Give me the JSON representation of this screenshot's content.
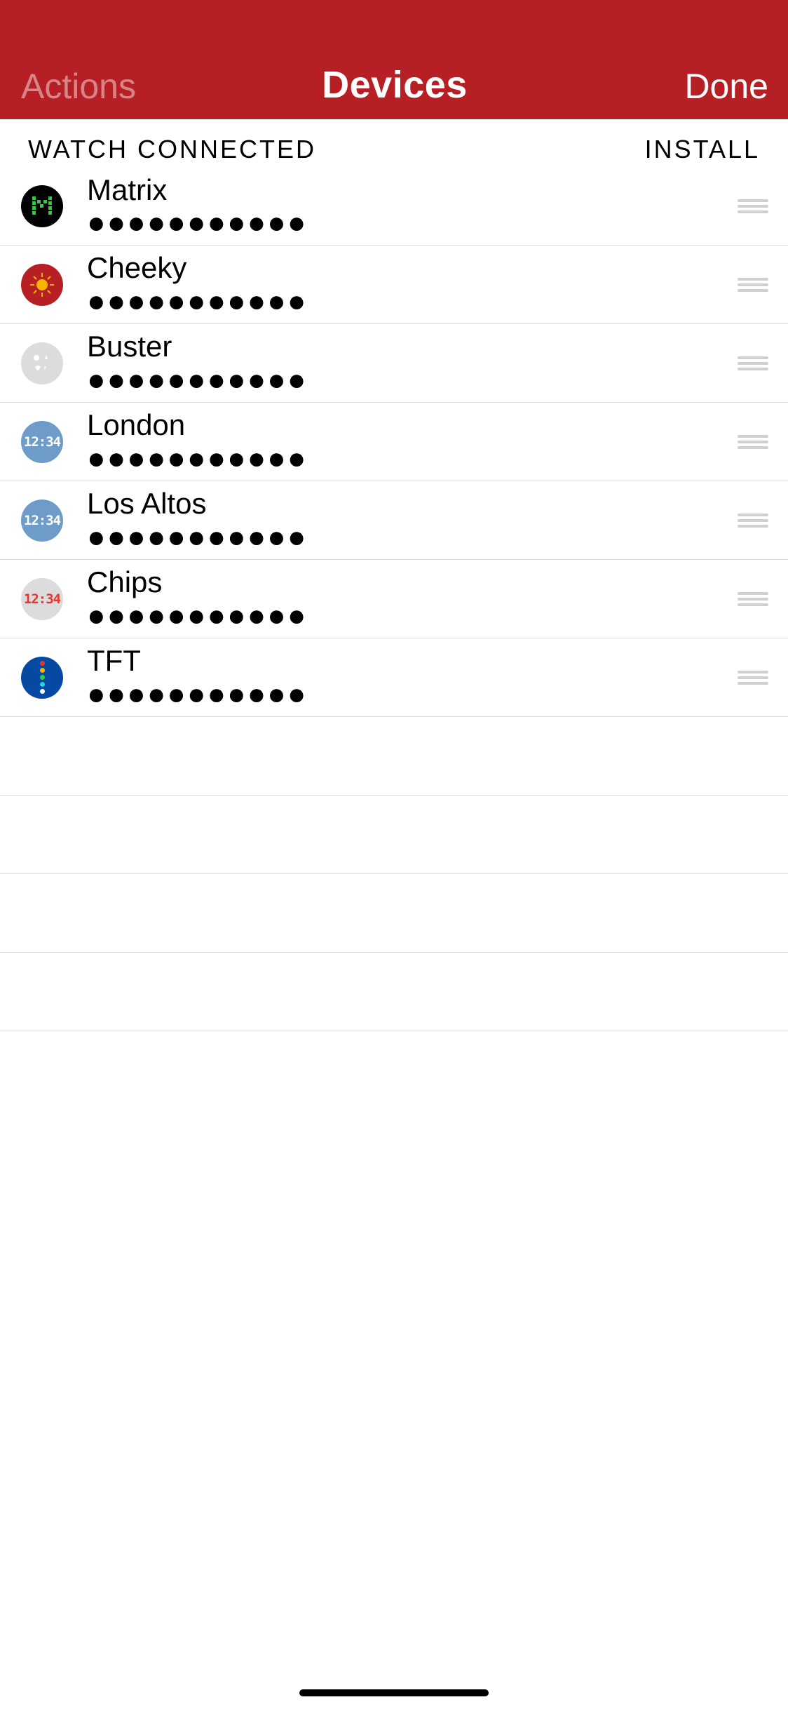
{
  "nav": {
    "left": "Actions",
    "title": "Devices",
    "right": "Done"
  },
  "section": {
    "left": "WATCH CONNECTED",
    "right": "INSTALL"
  },
  "rows": [
    {
      "title": "Matrix",
      "dots": "●●●●●●●●●●●"
    },
    {
      "title": "Cheeky",
      "dots": "●●●●●●●●●●●"
    },
    {
      "title": "Buster",
      "dots": "●●●●●●●●●●●"
    },
    {
      "title": "London",
      "dots": "●●●●●●●●●●●"
    },
    {
      "title": "Los Altos",
      "dots": "●●●●●●●●●●●"
    },
    {
      "title": "Chips",
      "dots": "●●●●●●●●●●●"
    },
    {
      "title": "TFT",
      "dots": "●●●●●●●●●●●"
    }
  ],
  "clock_text": "12:34"
}
